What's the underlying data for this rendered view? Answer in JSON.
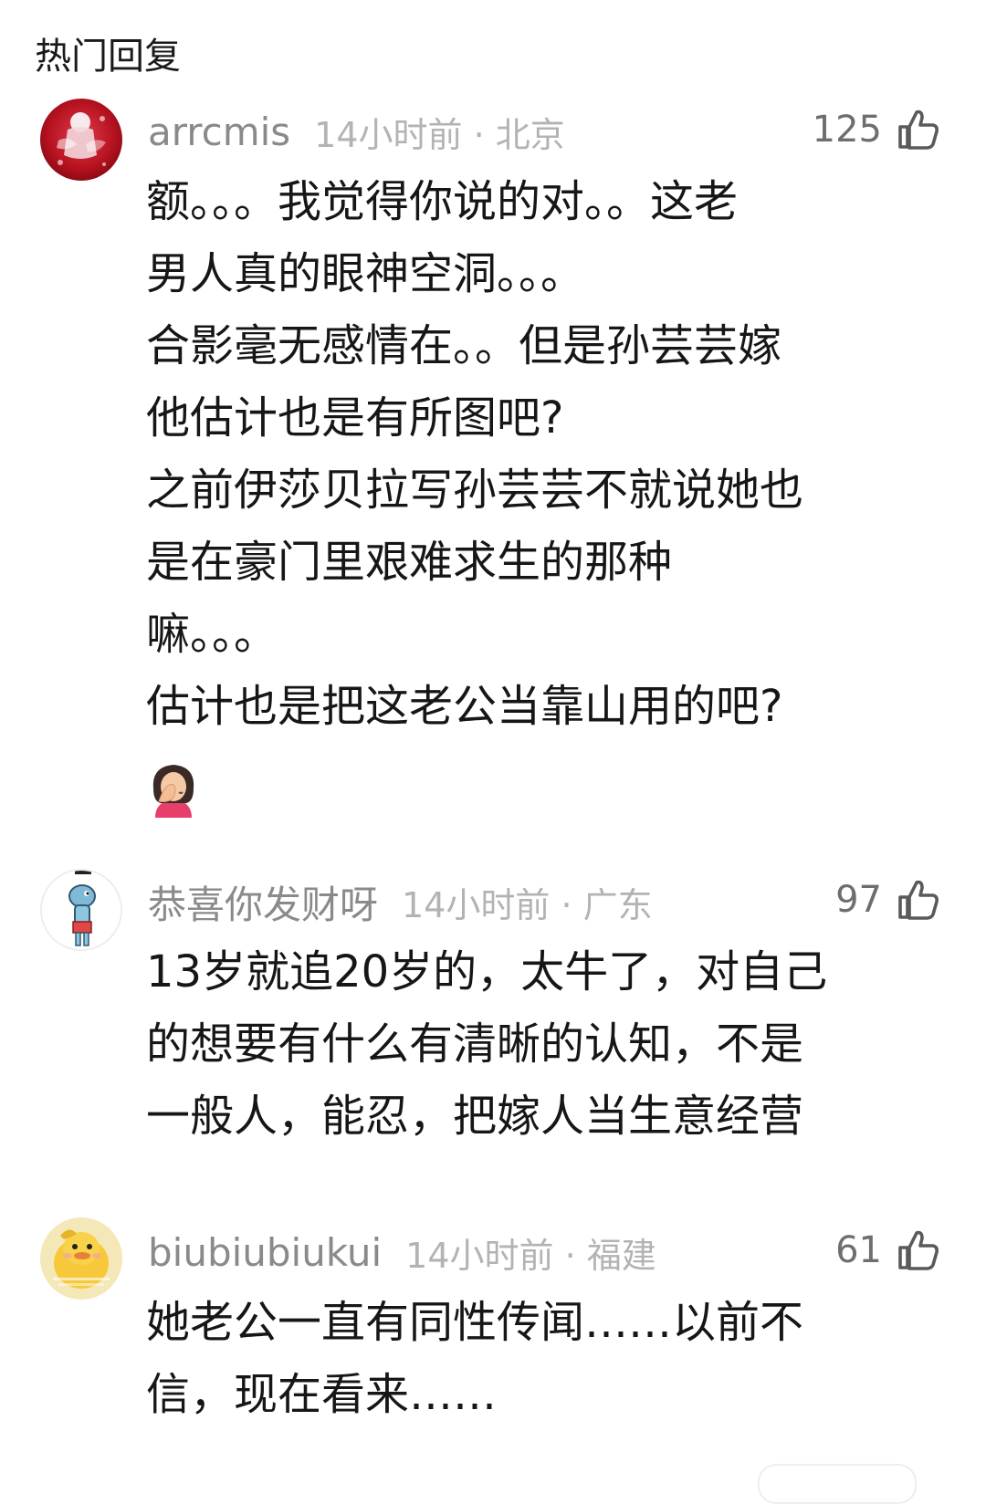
{
  "section_title": "热门回复",
  "comments": [
    {
      "username": "arrcmis",
      "time": "14小时前 · 北京",
      "likes": "125",
      "text": "额。。。我觉得你说的对。。这老\n男人真的眼神空洞。。。\n合影毫无感情在。。但是孙芸芸嫁\n他估计也是有所图吧?\n之前伊莎贝拉写孙芸芸不就说她也\n是在豪门里艰难求生的那种\n嘛。。。\n估计也是把这老公当靠山用的吧?",
      "avatar_icon": "anime-avatar-icon",
      "emoji_icon": "face-palm-emoji-icon"
    },
    {
      "username": "恭喜你发财呀",
      "time": "14小时前 · 广东",
      "likes": "97",
      "text": "13岁就追20岁的，太牛了，对自己\n的想要有什么有清晰的认知，不是\n一般人，能忍，把嫁人当生意经营",
      "avatar_icon": "cartoon-fish-avatar-icon"
    },
    {
      "username": "biubiubiukui",
      "time": "14小时前 · 福建",
      "likes": "61",
      "text": "她老公一直有同性传闻……以前不\n信，现在看来……",
      "avatar_icon": "yellow-duck-avatar-icon"
    }
  ],
  "colors": {
    "username": "#8a8a8a",
    "time": "#b3b3b3",
    "body": "#161616",
    "like_icon": "#5a5a5a"
  },
  "icons": {
    "like": "thumbs-up-icon"
  }
}
